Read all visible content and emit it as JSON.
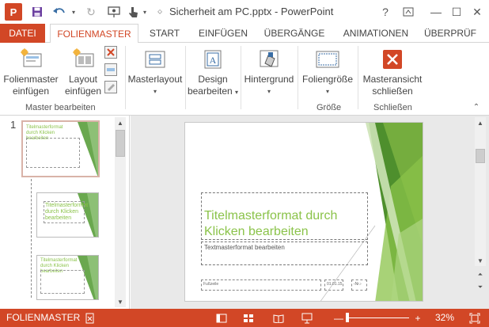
{
  "app": {
    "logo_letter": "P",
    "window_title": "Sicherheit am PC.pptx - PowerPoint",
    "controls": {
      "help": "?",
      "restore": "↥",
      "minimize": "—",
      "maximize": "☐",
      "close": "✕"
    }
  },
  "tabs": {
    "file": "DATEI",
    "items": [
      "FOLIENMASTER",
      "START",
      "EINFÜGEN",
      "ÜBERGÄNGE",
      "ANIMATIONEN",
      "ÜBERPRÜF"
    ]
  },
  "ribbon": {
    "insert_master": "Folienmaster einfügen",
    "insert_master_l1": "Folienmaster",
    "insert_master_l2": "einfügen",
    "insert_layout_l1": "Layout",
    "insert_layout_l2": "einfügen",
    "master_layout": "Masterlayout",
    "edit_design_l1": "Design",
    "edit_design_l2": "bearbeiten",
    "background": "Hintergrund",
    "slide_size": "Foliengröße",
    "close_l1": "Masteransicht",
    "close_l2": "schließen",
    "group_master_edit": "Master bearbeiten",
    "group_size": "Größe",
    "group_close": "Schließen"
  },
  "thumbnails": {
    "number": "1",
    "thumb1_title": "Titelmasterformat durch Klicken bearbeiten",
    "thumb2_title": "Titelmasterformat durch Klicken bearbeiten",
    "thumb3_title": "Titelmasterformat durch Klicken bearbeiten"
  },
  "slide": {
    "title": "Titelmasterformat durch Klicken bearbeiten",
    "subtitle": "Textmasterformat bearbeiten",
    "footer_left": "Fußzeile",
    "footer_mid": "01.01.15",
    "footer_right": "‹Nr.›"
  },
  "status": {
    "view_name": "FOLIENMASTER",
    "zoom": "32%"
  },
  "colors": {
    "accent": "#d24726",
    "green_dark": "#6aa84f",
    "green_light": "#8bc34a"
  }
}
